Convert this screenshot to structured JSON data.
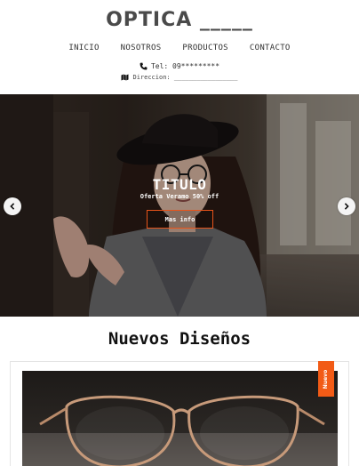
{
  "header": {
    "brand": "OPTICA _____",
    "nav": [
      "INICIO",
      "NOSOTROS",
      "PRODUCTOS",
      "CONTACTO"
    ],
    "tel": "Tel: 09*********",
    "direccion": "Direccion: _________________"
  },
  "hero": {
    "title": "TITULO",
    "subtitle": "Oferta Veramo 50% off",
    "button": "Mas info"
  },
  "section": {
    "title": "Nuevos Diseños"
  },
  "product": {
    "badge": "Nuevo"
  },
  "icons": {
    "phone": "phone-icon",
    "map": "map-icon",
    "prev": "chevron-left-icon",
    "next": "chevron-right-icon"
  },
  "colors": {
    "accent": "#e8541a",
    "badge": "#f25b16"
  }
}
